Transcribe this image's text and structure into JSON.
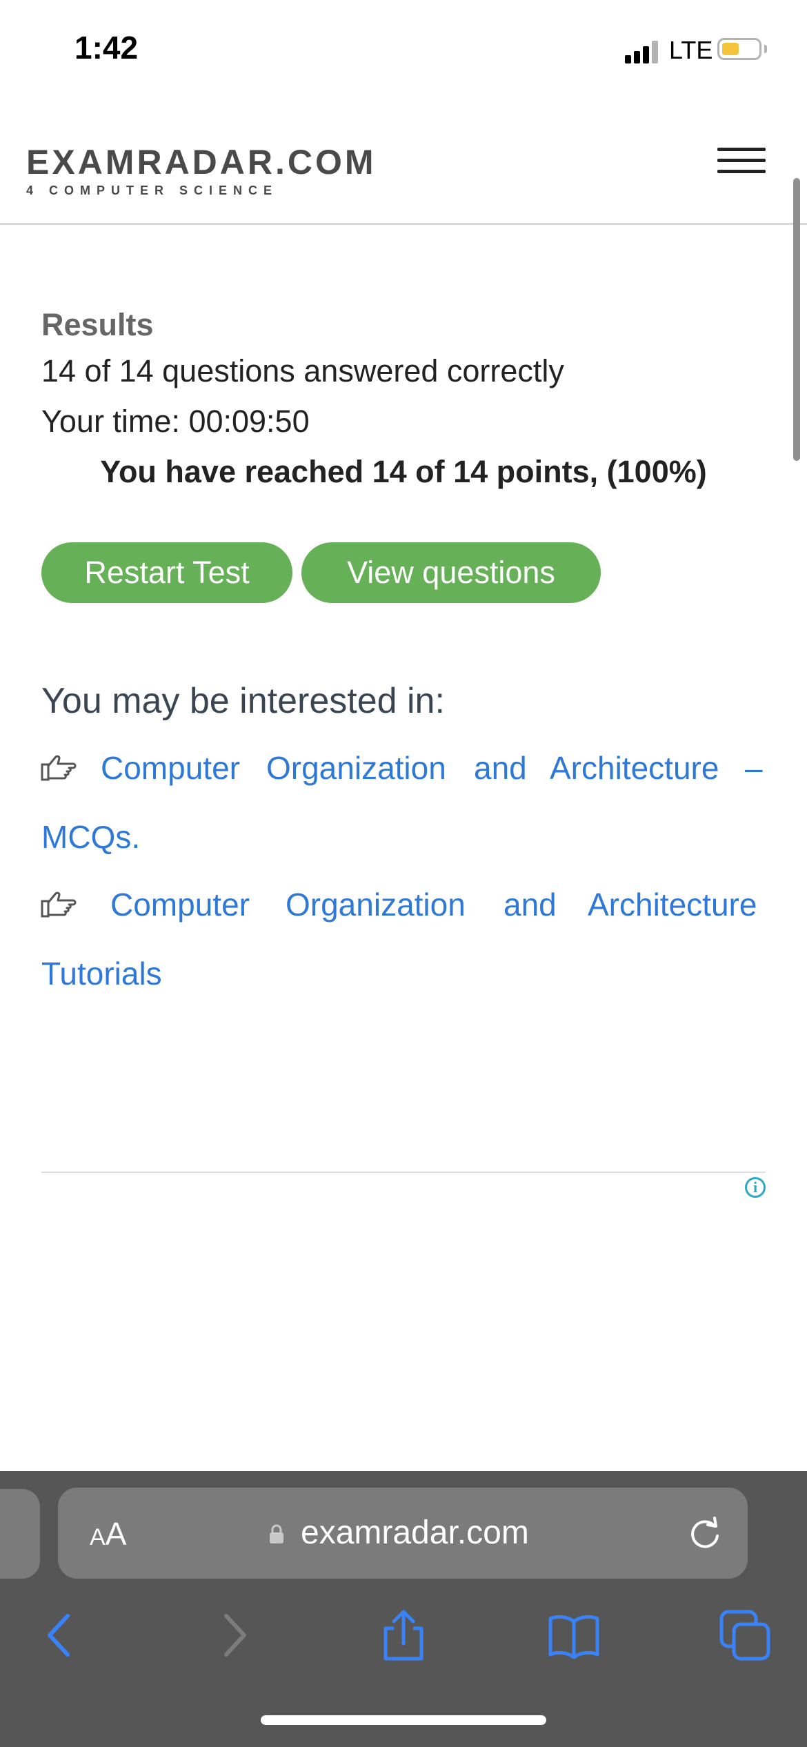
{
  "status_bar": {
    "time": "1:42",
    "network": "LTE",
    "battery_color": "#f5c43b"
  },
  "site": {
    "logo_main": "EXAMRADAR.COM",
    "logo_sub": "4 COMPUTER SCIENCE",
    "menu_icon": "hamburger-menu-icon"
  },
  "results": {
    "title": "Results",
    "correct_line": "14 of 14 questions answered correctly",
    "time_line": "Your time: 00:09:50",
    "points_line": "You have reached 14 of 14 points, (100%)",
    "restart_label": "Restart Test",
    "view_label": "View questions",
    "button_color": "#66b057"
  },
  "interest": {
    "title": "You may be interested in:",
    "link_icon": "hand-pointing-icon",
    "links": [
      {
        "line1": [
          "Computer",
          "Organization",
          "and",
          "Architecture",
          "–"
        ],
        "line2": "MCQs."
      },
      {
        "line1": [
          "Computer",
          "Organization",
          "and",
          "Architecture"
        ],
        "line2": "Tutorials"
      }
    ],
    "link_color": "#2e78d8"
  },
  "ad": {
    "info_icon": "info-icon",
    "info_symbol": "i"
  },
  "browser": {
    "text_size_small": "A",
    "text_size_big": "A",
    "url": "examradar.com",
    "icons": [
      "back-icon",
      "forward-icon",
      "share-icon",
      "bookmarks-icon",
      "tabs-icon",
      "lock-icon",
      "reload-icon"
    ],
    "accent": "#3a82f7"
  }
}
